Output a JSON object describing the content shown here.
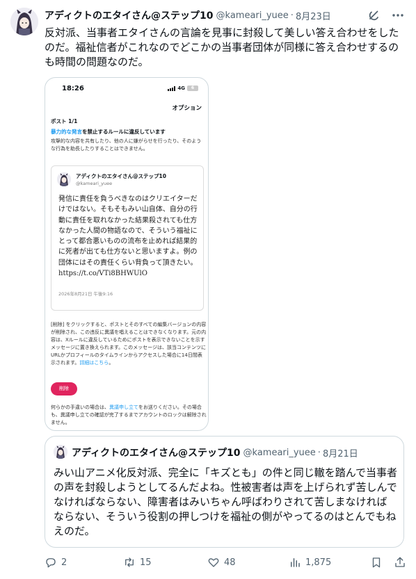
{
  "tweet": {
    "author_name": "アディクトのエタイさん@ステップ10",
    "handle": "@kameari_yuee",
    "separator": "·",
    "date": "8月23日",
    "text": "反対派、当事者エタイさんの言論を見事に封殺して美しい答え合わせをしたのだ。福祉信者がこれなのでどこかの当事者団体が同様に答え合わせするのも時間の問題なのだ。"
  },
  "top_icons": [
    "grok-icon",
    "more-icon"
  ],
  "screenshot": {
    "time": "18:26",
    "network": "4G",
    "battery": "6",
    "options": "オプション",
    "post_num": "ポスト 1/1",
    "violation_link": "暴力的な発言",
    "violation_rest": "を禁止するルールに違反しています",
    "description": "攻撃的な内容を共有したり、他の人に嫌がらせを行ったり、そのような行為を助長したりすることはできません。",
    "card": {
      "name": "アディクトのエタイさん@ステップ10",
      "handle": "@kameari_yuee",
      "body": "発信に責任を負うべきなのはクリエイターだけではない。そもそもみい山自体、自分の行動に責任を取れなかった結果殺されても仕方なかった人間の物語なので、そういう福祉にとって都合悪いものの流布を止めれば結果的に死者が出ても仕方ないと思いますよ。例の団体にはその責任くらい背負って頂きたい。 https://t.co/VTi8BHWUlO",
      "date": "2026年8月21日 午後9:16"
    },
    "delete_info": "[削除] をクリックすると、ポストとそのすべての編集バージョンの内容が削除され、この违反に異議を唱えることはできなくなります。元の内容は、Xルールに違反しているためにポストを表示できないことを示すメッセージに置き換えられます。このメッセージは、該当コンテンツにURLかプロフィールのタイムラインからアクセスした場合に14日間表示されます。",
    "delete_info_link": "詳細はこちら",
    "delete_info_end": "。",
    "delete_button": "削除",
    "appeal_pre": "何らかの手違いの場合は、",
    "appeal_link": "異議申し立て",
    "appeal_post": "をお送りください。その場合も、異議申し立ての確認が完了するまでアカウントのロックは解除されません。"
  },
  "quote": {
    "author_name": "アディクトのエタイさん@ステップ10",
    "handle": "@kameari_yuee",
    "separator": "·",
    "date": "8月21日",
    "text": "みい山アニメ化反対派、完全に「キズとも」の件と同じ轍を踏んで当事者の声を封殺しようとしてるんだよね。性被害者は声を上げられず苦しんでなければならない、障害者はみいちゃん呼ばわりされて苦しまなければならない、そういう役割の押しつけを福祉の側がやってるのはとんでもねえのだ。"
  },
  "actions": {
    "replies": "2",
    "reposts": "15",
    "likes": "48",
    "views": "1,875"
  }
}
